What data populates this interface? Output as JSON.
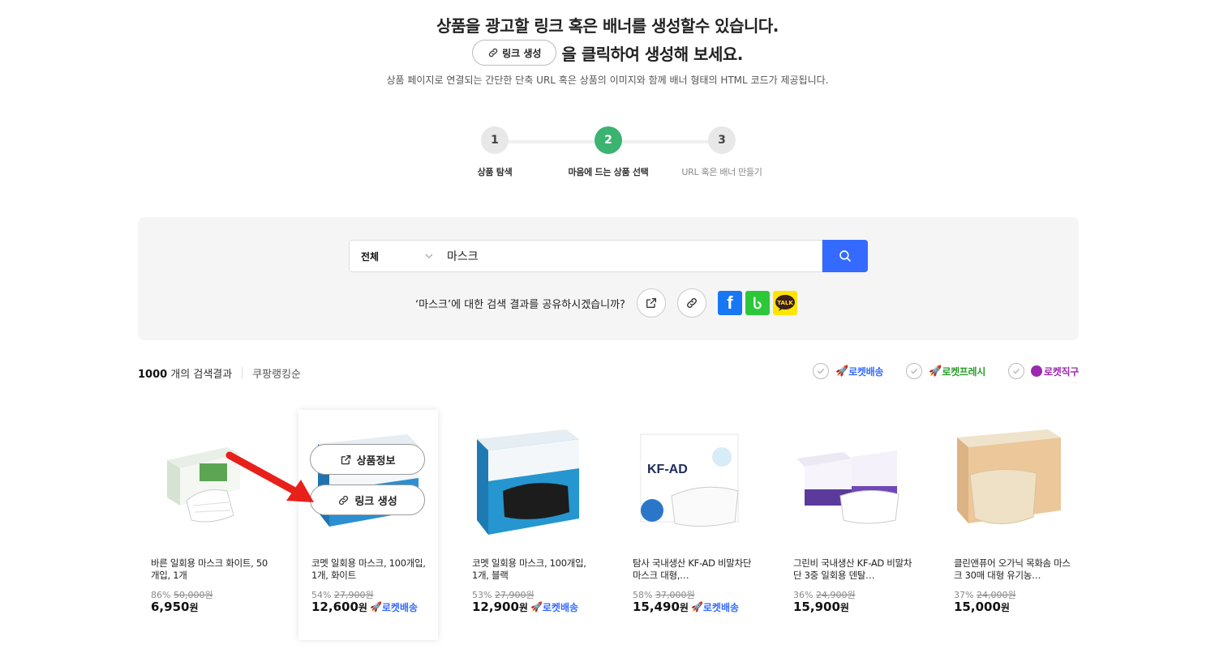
{
  "hero": {
    "line1": "상품을 광고할 링크 혹은 배너를 생성할수 있습니다.",
    "button_label": "링크 생성",
    "line2": "을 클릭하여 생성해 보세요.",
    "subtitle": "상품 페이지로 연결되는 간단한 단축 URL 혹은 상품의 이미지와 함께 배너 형태의 HTML 코드가 제공됩니다."
  },
  "steps": [
    {
      "number": "1",
      "label": "상품 탐색",
      "state": "done"
    },
    {
      "number": "2",
      "label": "마음에 드는 상품 선택",
      "state": "active"
    },
    {
      "number": "3",
      "label": "URL 혹은 배너 만들기",
      "state": "pending"
    }
  ],
  "search": {
    "category": "전체",
    "query": "마스크",
    "share_text": "‘마스크’에 대한 검색 결과를 공유하시겠습니까?",
    "icons": [
      "external-link-icon",
      "link-icon",
      "facebook-icon",
      "band-icon",
      "kakaotalk-icon"
    ],
    "kakao_label": "TALK",
    "facebook_label": "f"
  },
  "results": {
    "count": "1000",
    "count_suffix": " 개의 검색결과",
    "sort": "쿠팡랭킹순",
    "filters": [
      {
        "label": "로켓배송",
        "color": "#346aff"
      },
      {
        "label": "로켓프레시",
        "color": "#2a9d2a"
      },
      {
        "label": "로켓직구",
        "color": "#9c27b0"
      }
    ]
  },
  "overlay": {
    "info_label": "상품정보",
    "link_label": "링크 생성"
  },
  "products": [
    {
      "name": "바른 일회용 마스크 화이트, 50개입, 1개",
      "discount": "86%",
      "old_price": "50,000원",
      "price": "6,950",
      "unit": "원",
      "rocket": ""
    },
    {
      "name": "코멧 일회용 마스크, 100개입, 1개, 화이트",
      "discount": "54%",
      "old_price": "27,900원",
      "price": "12,600",
      "unit": "원",
      "rocket": "로켓배송"
    },
    {
      "name": "코멧 일회용 마스크, 100개입, 1개, 블랙",
      "discount": "53%",
      "old_price": "27,900원",
      "price": "12,900",
      "unit": "원",
      "rocket": "로켓배송"
    },
    {
      "name": "탐사 국내생산 KF-AD 비말차단 마스크 대형,…",
      "discount": "58%",
      "old_price": "37,000원",
      "price": "15,490",
      "unit": "원",
      "rocket": "로켓배송"
    },
    {
      "name": "그린비 국내생산 KF-AD 비말차단 3중 일회용 덴탈…",
      "discount": "36%",
      "old_price": "24,900원",
      "price": "15,900",
      "unit": "원",
      "rocket": ""
    },
    {
      "name": "클린앤퓨어 오가닉 목화솜 마스크 30매 대형 유기농…",
      "discount": "37%",
      "old_price": "24,000원",
      "price": "15,000",
      "unit": "원",
      "rocket": ""
    }
  ],
  "colors": {
    "accent_blue": "#346aff",
    "step_active": "#3cb371",
    "annotation_arrow": "#e8201a"
  }
}
